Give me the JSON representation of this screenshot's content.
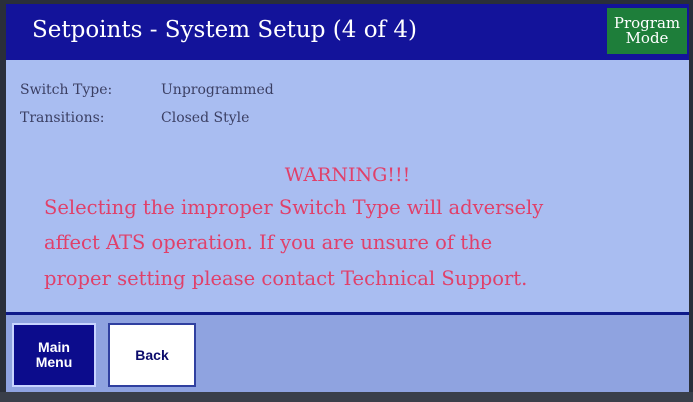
{
  "header": {
    "title": "Setpoints - System Setup (4 of 4)",
    "mode_line1": "Program",
    "mode_line2": "Mode"
  },
  "info": {
    "switch_type_label": "Switch Type:",
    "switch_type_value": "Unprogrammed",
    "transitions_label": "Transitions:",
    "transitions_value": "Closed Style"
  },
  "warning": {
    "title": "WARNING!!!",
    "lines": [
      "Selecting the improper Switch Type will adversely",
      "affect ATS operation. If you are unsure of the",
      "proper setting please contact Technical Support."
    ]
  },
  "buttons": {
    "main_menu_line1": "Main",
    "main_menu_line2": "Menu",
    "back": "Back"
  },
  "colors": {
    "header_bg": "#13139a",
    "screen_bg": "#a9bdf1",
    "mode_badge_bg": "#1e7e3a",
    "warning_text": "#e0406a"
  }
}
